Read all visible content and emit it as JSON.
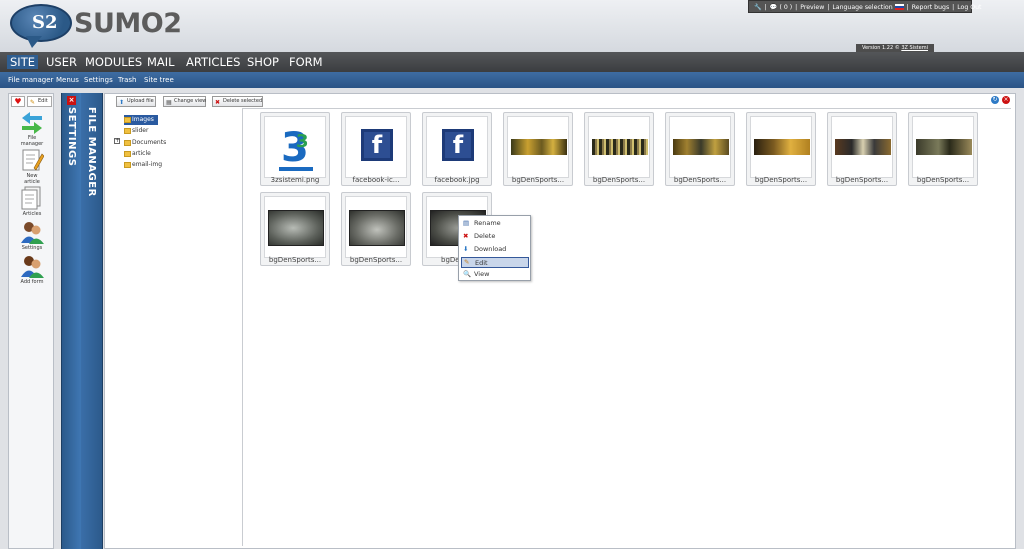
{
  "header": {
    "logo_text": "SUMO2",
    "logo_mark": "S2",
    "version": "Version 1.22 ©",
    "version_link": "3Z Sistemi",
    "topbar": {
      "notifications": "( 0 )",
      "links": [
        "Preview",
        "Language selection",
        "Report bugs",
        "Log Out"
      ]
    }
  },
  "main_nav": [
    "SITE",
    "USER",
    "MODULES",
    "MAIL",
    "ARTICLES",
    "SHOP",
    "FORM"
  ],
  "sub_nav": [
    "File manager",
    "Menus",
    "Settings",
    "Trash",
    "Site tree"
  ],
  "left_panel": {
    "edit_label": "Edit",
    "tools": [
      {
        "label": "File\nmanager",
        "icon": "file-manager-icon"
      },
      {
        "label": "New\narticle",
        "icon": "new-article-icon"
      },
      {
        "label": "Articles",
        "icon": "articles-icon"
      },
      {
        "label": "Settings",
        "icon": "settings-users-icon"
      },
      {
        "label": "Add form",
        "icon": "add-form-icon"
      }
    ]
  },
  "strips": {
    "settings": "SETTINGS",
    "file_manager": "FILE MANAGER"
  },
  "toolbar": {
    "upload": "Upload file",
    "change_view": "Change view",
    "delete_selected": "Delete selected"
  },
  "tree": [
    "Images",
    "slider",
    "Documents",
    "article",
    "email-img"
  ],
  "files": [
    "3zsistemi.png",
    "facebook-ic...",
    "facebook.jpg",
    "bgDenSports...",
    "bgDenSports...",
    "bgDenSports...",
    "bgDenSports...",
    "bgDenSports...",
    "bgDenSports...",
    "bgDenSports...",
    "bgDenSports...",
    "bgDenSp"
  ],
  "context_menu": [
    "Rename",
    "Delete",
    "Download",
    "Edit",
    "View"
  ],
  "colors": {
    "accent": "#2f5e91",
    "nav_bg": "#3b3d40",
    "subnav_bg": "#2a5385"
  }
}
